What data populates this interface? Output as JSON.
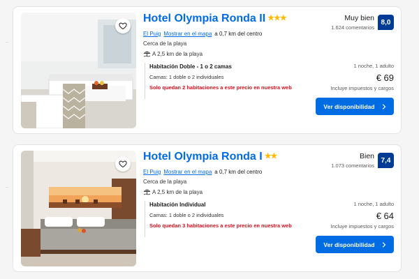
{
  "results": [
    {
      "name": "Hotel Olympia Ronda II",
      "stars": "★★★",
      "town": "El Puig",
      "map_link": "Mostrar en el mapa",
      "distance": "a 0,7 km del centro",
      "near": "Cerca de la playa",
      "beach": "A 2,5 km de la playa",
      "room_name": "Habitación Doble - 1 o 2 camas",
      "room_beds": "Camas: 1 doble o 2 individuales",
      "scarcity": "Solo quedan 2 habitaciones a este precio en nuestra web",
      "rating_word": "Muy bien",
      "rating_count": "1.624 comentarios",
      "score": "8,0",
      "stay": "1 noche, 1 adulto",
      "price": "€ 69",
      "taxes": "Incluye impuestos y cargos",
      "cta": "Ver disponibilidad"
    },
    {
      "name": "Hotel Olympia Ronda I",
      "stars": "★★",
      "town": "El Puig",
      "map_link": "Mostrar en el mapa",
      "distance": "a 0,7 km del centro",
      "near": "Cerca de la playa",
      "beach": "A 2,5 km de la playa",
      "room_name": "Habitación Individual",
      "room_beds": "Camas: 1 doble o 2 individuales",
      "scarcity": "Solo quedan 3 habitaciones a este precio en nuestra web",
      "rating_word": "Bien",
      "rating_count": "1.073 comentarios",
      "score": "7,4",
      "stay": "1 noche, 1 adulto",
      "price": "€ 64",
      "taxes": "Incluye impuestos y cargos",
      "cta": "Ver disponibilidad"
    }
  ],
  "icons": {
    "favorite": "heart-outline-icon",
    "beach": "beach-umbrella-icon",
    "cta_arrow": "chevron-right-icon"
  },
  "colors": {
    "link": "#006ce4",
    "score_bg": "#003b95",
    "button": "#006ce4",
    "stars": "#febb02",
    "scarcity": "#d4111e"
  }
}
